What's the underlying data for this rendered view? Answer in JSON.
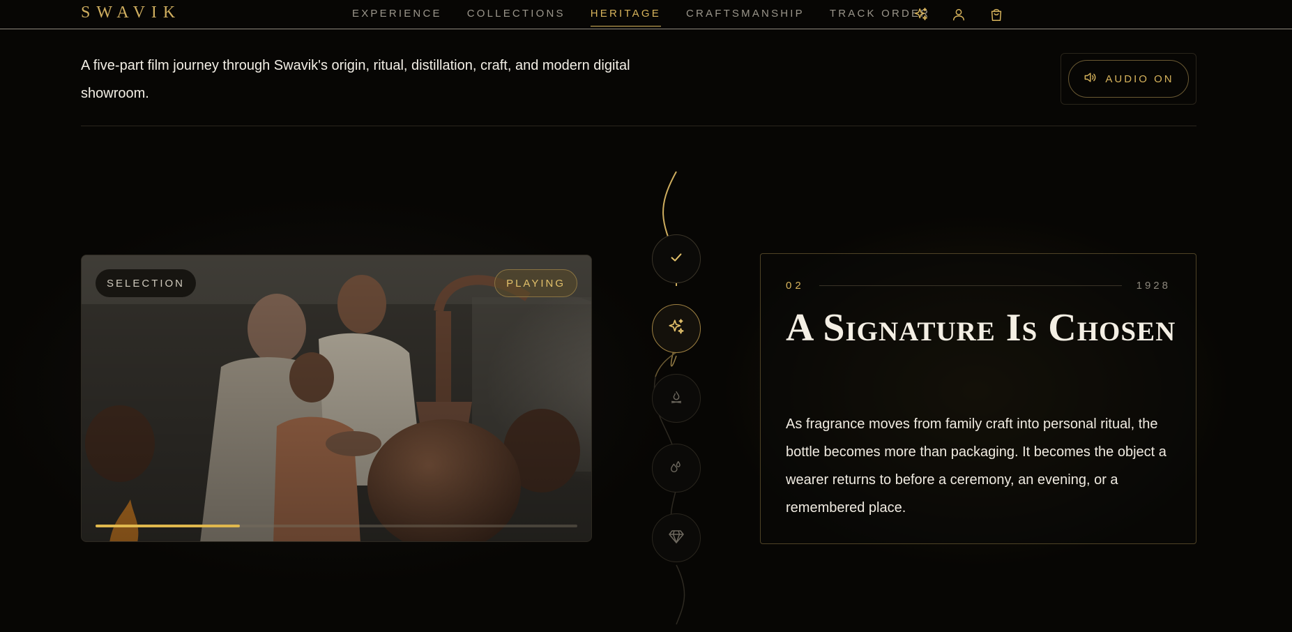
{
  "header": {
    "logo": "SWAVIK",
    "nav": [
      {
        "label": "EXPERIENCE",
        "active": false
      },
      {
        "label": "COLLECTIONS",
        "active": false
      },
      {
        "label": "HERITAGE",
        "active": true
      },
      {
        "label": "CRAFTSMANSHIP",
        "active": false
      },
      {
        "label": "TRACK ORDER",
        "active": false
      }
    ],
    "icons": [
      "sparkles-icon",
      "user-icon",
      "shopping-bag-icon"
    ]
  },
  "intro": {
    "text": "A five-part film journey through Swavik's origin, ritual, distillation, craft, and modern digital showroom."
  },
  "audio": {
    "label": "AUDIO ON",
    "icon": "speaker-icon"
  },
  "media": {
    "chapter_label": "SELECTION",
    "status_label": "PLAYING",
    "progress": 0.3
  },
  "timeline": {
    "nodes": [
      {
        "icon": "check-icon",
        "state": "done"
      },
      {
        "icon": "sparkles-icon",
        "state": "active"
      },
      {
        "icon": "flame-icon",
        "state": "upcoming"
      },
      {
        "icon": "droplets-icon",
        "state": "upcoming"
      },
      {
        "icon": "gem-icon",
        "state": "upcoming"
      }
    ]
  },
  "story": {
    "number": "02",
    "year": "1928",
    "title": "A Signature Is Chosen",
    "body": "As fragrance moves from family craft into personal ritual, the bottle becomes more than packaging. It becomes the object a wearer returns to before a ceremony, an evening, or a remembered place."
  },
  "colors": {
    "accent": "#d8b45c",
    "background": "#070604",
    "muted": "#9b968b"
  }
}
